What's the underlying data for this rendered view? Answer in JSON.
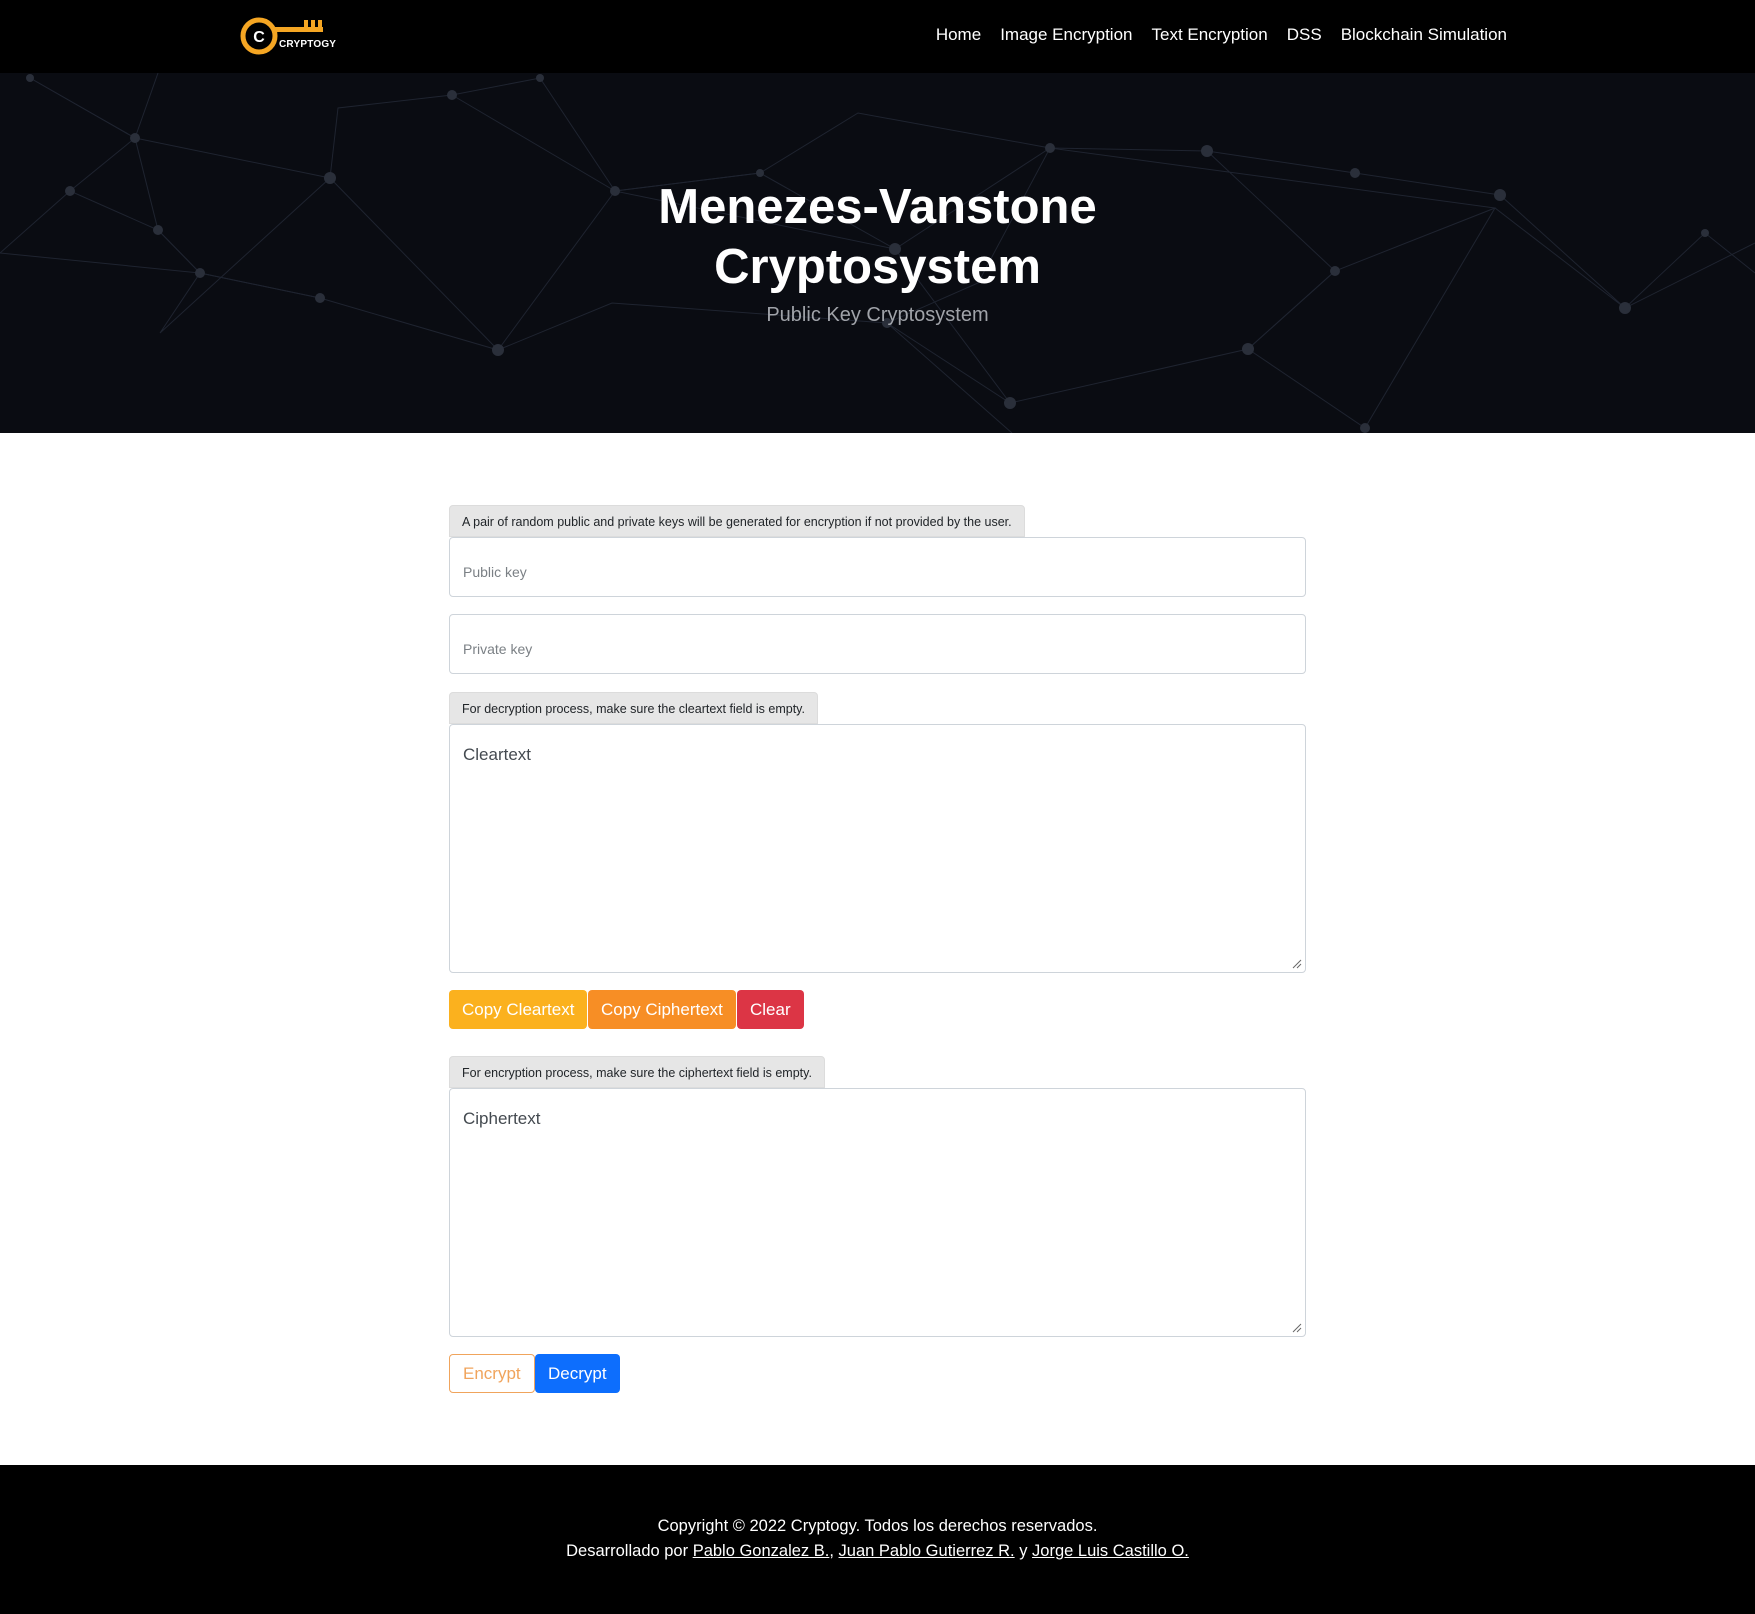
{
  "brand": {
    "logo_text": "CRYPTOGY",
    "accent": "#f5a623"
  },
  "nav": {
    "items": [
      {
        "label": "Home"
      },
      {
        "label": "Image Encryption"
      },
      {
        "label": "Text Encryption"
      },
      {
        "label": "DSS"
      },
      {
        "label": "Blockchain Simulation"
      }
    ]
  },
  "hero": {
    "title_line1": "Menezes-Vanstone",
    "title_line2": "Cryptosystem",
    "subtitle": "Public Key Cryptosystem"
  },
  "form": {
    "keys_note": "A pair of random public and private keys will be generated for encryption if not provided by the user.",
    "public_key_placeholder": "Public key",
    "private_key_placeholder": "Private key",
    "decrypt_note": "For decryption process, make sure the cleartext field is empty.",
    "cleartext_placeholder": "Cleartext",
    "copy_cleartext_label": "Copy Cleartext",
    "copy_ciphertext_label": "Copy Ciphertext",
    "clear_label": "Clear",
    "encrypt_note": "For encryption process, make sure the ciphertext field is empty.",
    "ciphertext_placeholder": "Ciphertext",
    "encrypt_label": "Encrypt",
    "decrypt_label": "Decrypt"
  },
  "colors": {
    "copy_cleartext": "#fbb11e",
    "copy_ciphertext": "#f78e25",
    "clear": "#dc3545",
    "decrypt": "#0d6efd",
    "encrypt_outline": "#f0a45c"
  },
  "footer": {
    "copyright": "Copyright © 2022 Cryptogy. Todos los derechos reservados.",
    "developed_prefix": "Desarrollado por ",
    "dev1": "Pablo Gonzalez B.",
    "sep1": ", ",
    "dev2": "Juan Pablo Gutierrez R.",
    "sep2": " y ",
    "dev3": "Jorge Luis Castillo O."
  }
}
